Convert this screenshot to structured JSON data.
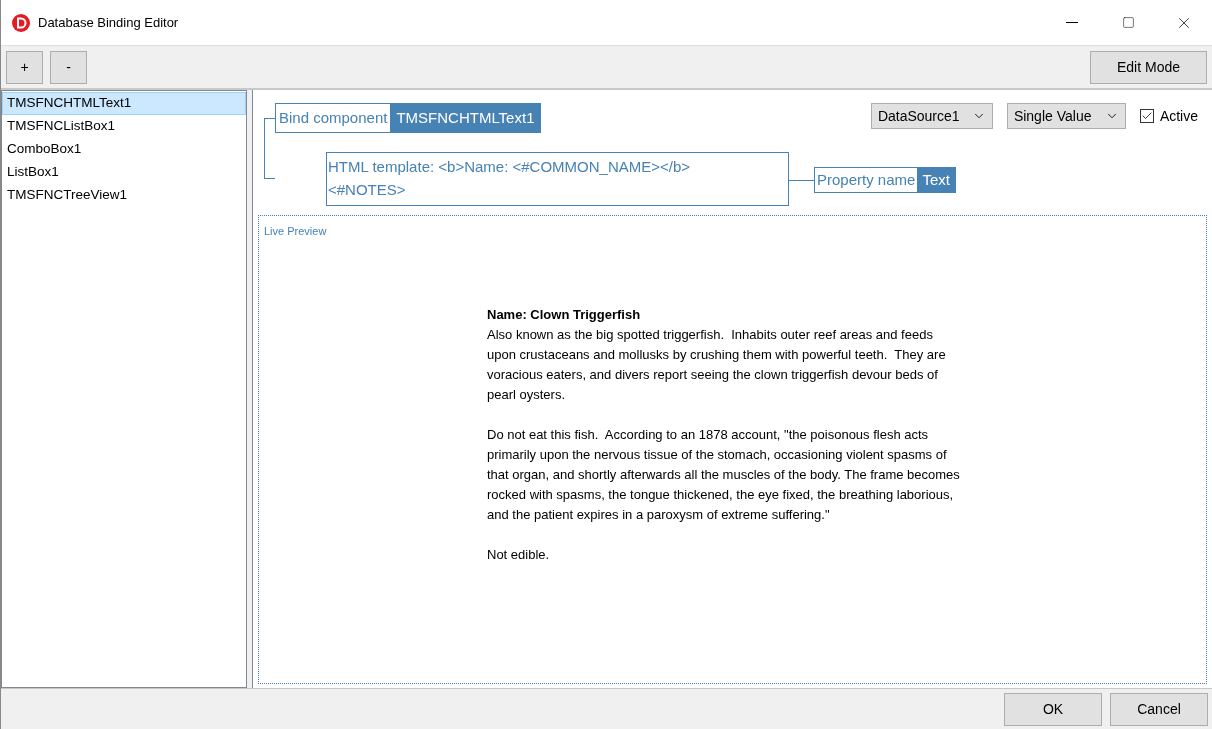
{
  "window": {
    "title": "Database Binding Editor"
  },
  "toolbar": {
    "buttons": [
      "+",
      "-"
    ],
    "mode_button": "Edit Mode"
  },
  "sidebar": {
    "items": [
      {
        "label": "TMSFNCHTMLText1",
        "selected": true
      },
      {
        "label": "TMSFNCListBox1",
        "selected": false
      },
      {
        "label": "ComboBox1",
        "selected": false
      },
      {
        "label": "ListBox1",
        "selected": false
      },
      {
        "label": "TMSFNCTreeView1",
        "selected": false
      }
    ]
  },
  "binding": {
    "component": {
      "label": "Bind component",
      "value": "TMSFNCHTMLText1"
    },
    "template": "HTML template: <b>Name: <#COMMON_NAME></b> <#NOTES>",
    "property": {
      "label": "Property name",
      "value": "Text"
    }
  },
  "datasource": {
    "value": "DataSource1"
  },
  "mode": {
    "value": "Single Value"
  },
  "active": {
    "label": "Active",
    "checked": true
  },
  "preview": {
    "label": "Live Preview",
    "heading": "Name: Clown Triggerfish",
    "paragraphs": [
      "Also known as the big spotted triggerfish.  Inhabits outer reef areas and feeds upon crustaceans and mollusks by crushing them with powerful teeth.  They are voracious eaters, and divers report seeing the clown triggerfish devour beds of pearl oysters.",
      "Do not eat this fish.  According to an 1878 account, \"the poisonous flesh acts primarily upon the nervous tissue of the stomach, occasioning violent spasms of that organ, and shortly afterwards all the muscles of the body. The frame becomes rocked with spasms, the tongue thickened, the eye fixed, the breathing laborious, and the patient expires in a paroxysm of extreme suffering.\"",
      "Not edible."
    ]
  },
  "footer": {
    "buttons": [
      "OK",
      "Cancel"
    ]
  }
}
